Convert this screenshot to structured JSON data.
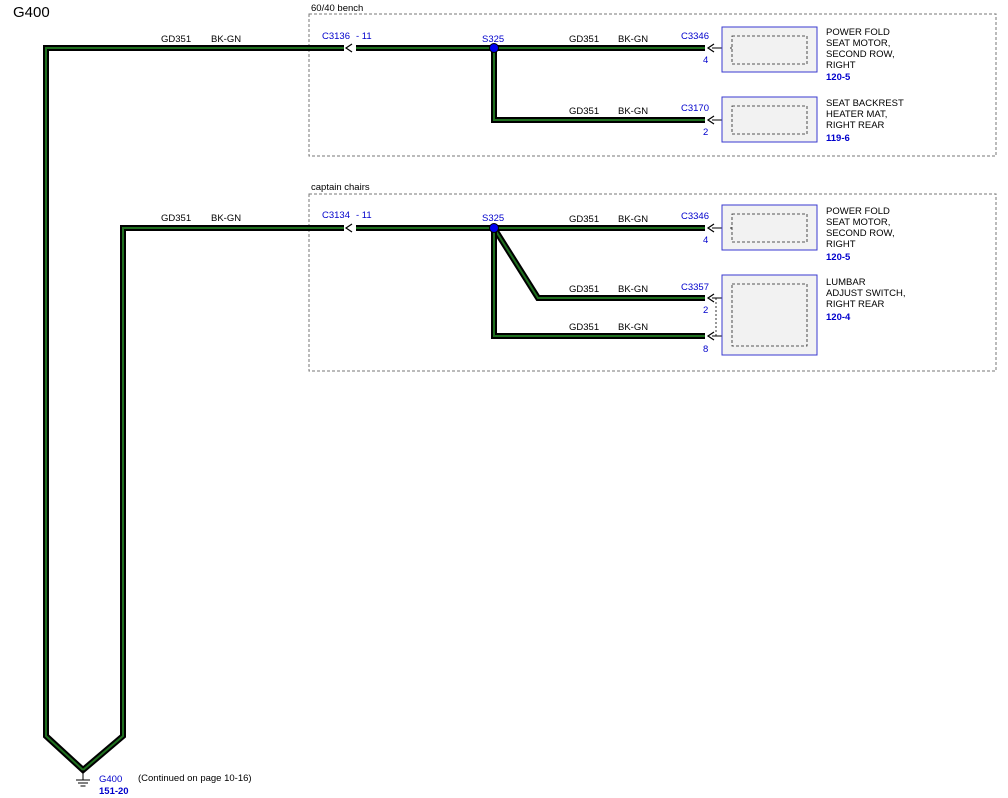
{
  "title": "G400",
  "groups": {
    "bench": {
      "label": "60/40 bench",
      "inline_connector": "C3136",
      "inline_pin": "- 11",
      "splice": "S325",
      "feed_circuit": "GD351",
      "feed_color": "BK-GN",
      "branches": [
        {
          "circuit": "GD351",
          "color": "BK-GN",
          "connector": "C3346",
          "pin": "4",
          "component_lines": [
            "POWER FOLD",
            "SEAT MOTOR,",
            "SECOND ROW,",
            "RIGHT"
          ],
          "ref": "120-5"
        },
        {
          "circuit": "GD351",
          "color": "BK-GN",
          "connector": "C3170",
          "pin": "2",
          "component_lines": [
            "SEAT BACKREST",
            "HEATER MAT,",
            "RIGHT REAR"
          ],
          "ref": "119-6"
        }
      ]
    },
    "captain": {
      "label": "captain chairs",
      "inline_connector": "C3134",
      "inline_pin": "- 11",
      "splice": "S325",
      "feed_circuit": "GD351",
      "feed_color": "BK-GN",
      "branches": [
        {
          "circuit": "GD351",
          "color": "BK-GN",
          "connector": "C3346",
          "pin": "4",
          "component_lines": [
            "POWER FOLD",
            "SEAT MOTOR,",
            "SECOND ROW,",
            "RIGHT"
          ],
          "ref": "120-5"
        },
        {
          "circuit": "GD351",
          "color": "BK-GN",
          "connector": "C3357",
          "pin": "2",
          "component_lines": [
            "LUMBAR",
            "ADJUST SWITCH,",
            "RIGHT REAR"
          ],
          "ref": "120-4"
        },
        {
          "circuit": "GD351",
          "color": "BK-GN",
          "pin": "8"
        }
      ]
    }
  },
  "ground": {
    "label": "G400",
    "ref": "151-20",
    "note": "(Continued on page 10-16)"
  },
  "colors": {
    "wire_outer": "#000000",
    "wire_inner": "#1f6f1f",
    "splice": "#0000ee",
    "label_blue": "#0000cc",
    "component_fill": "#f2f2f2",
    "component_border": "#3a3ad0"
  },
  "icons": {
    "ground": "ground-symbol-icon",
    "splice": "splice-dot-icon",
    "connector": "connector-chevron-icon"
  }
}
